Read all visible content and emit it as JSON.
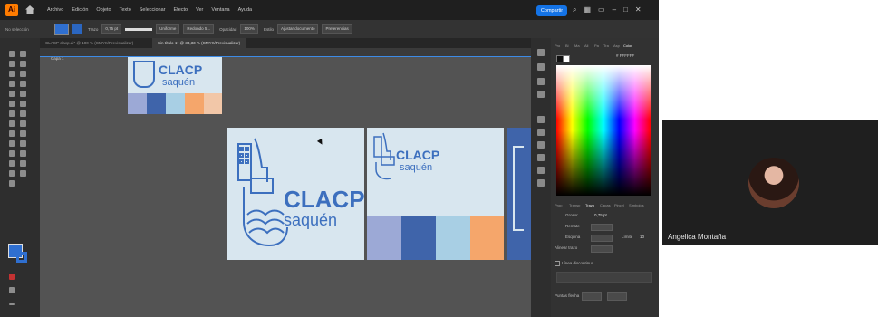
{
  "app": {
    "logo": "Ai",
    "menu": [
      "Archivo",
      "Edición",
      "Objeto",
      "Texto",
      "Seleccionar",
      "Efecto",
      "Ver",
      "Ventana",
      "Ayuda"
    ],
    "share_label": "Compartir",
    "top_icons": [
      "search-icon",
      "layout-icon",
      "window-icon"
    ]
  },
  "control_bar": {
    "selection_label": "No selección",
    "stroke_label": "Trazo",
    "stroke_value": "0,75 pt",
    "brush_label": "Uniforme",
    "style_label": "Redondo 5...",
    "opacity_label": "Opacidad",
    "opacity_value": "100%",
    "style2_label": "Estilo",
    "align_label": "Ajustar documento",
    "prefs_label": "Preferencias"
  },
  "tabs": [
    {
      "label": "CLACP clacp.ai* @ 100 % (CMYK/Previsualizar)",
      "active": false
    },
    {
      "label": "Sin título-1* @ 33,33 % (CMYK/Previsualizar)",
      "active": true
    }
  ],
  "layer_label": "Capa 1",
  "canvas": {
    "logo_word": "CLACP",
    "logo_sub": "saquén",
    "palette": [
      "#9ca9d6",
      "#3f64aa",
      "#a8cfe4",
      "#f5a66b",
      "#f2c7a8"
    ],
    "accent": "#3c6fbe"
  },
  "color_panel": {
    "tabs": [
      "Pro",
      "Bi",
      "Ma",
      "Ali",
      "Pa",
      "Tra",
      "Asp",
      "Color"
    ],
    "hex": "# FFFFFF"
  },
  "stroke_panel": {
    "tabs": [
      "Prop",
      "Transp",
      "Trazo",
      "Capas",
      "Pincel",
      "Símbolos"
    ],
    "grosor_label": "Grosor",
    "grosor_value": "0,75 pt",
    "remate_label": "Remate",
    "esquina_label": "Esquina",
    "limite_label": "Límite",
    "limite_value": "10",
    "alinear_label": "Alinear trazo",
    "linea_label": "Línea discontinua",
    "puntas_label": "Puntas flecha"
  },
  "participant": {
    "name": "Angelica Montaña"
  }
}
